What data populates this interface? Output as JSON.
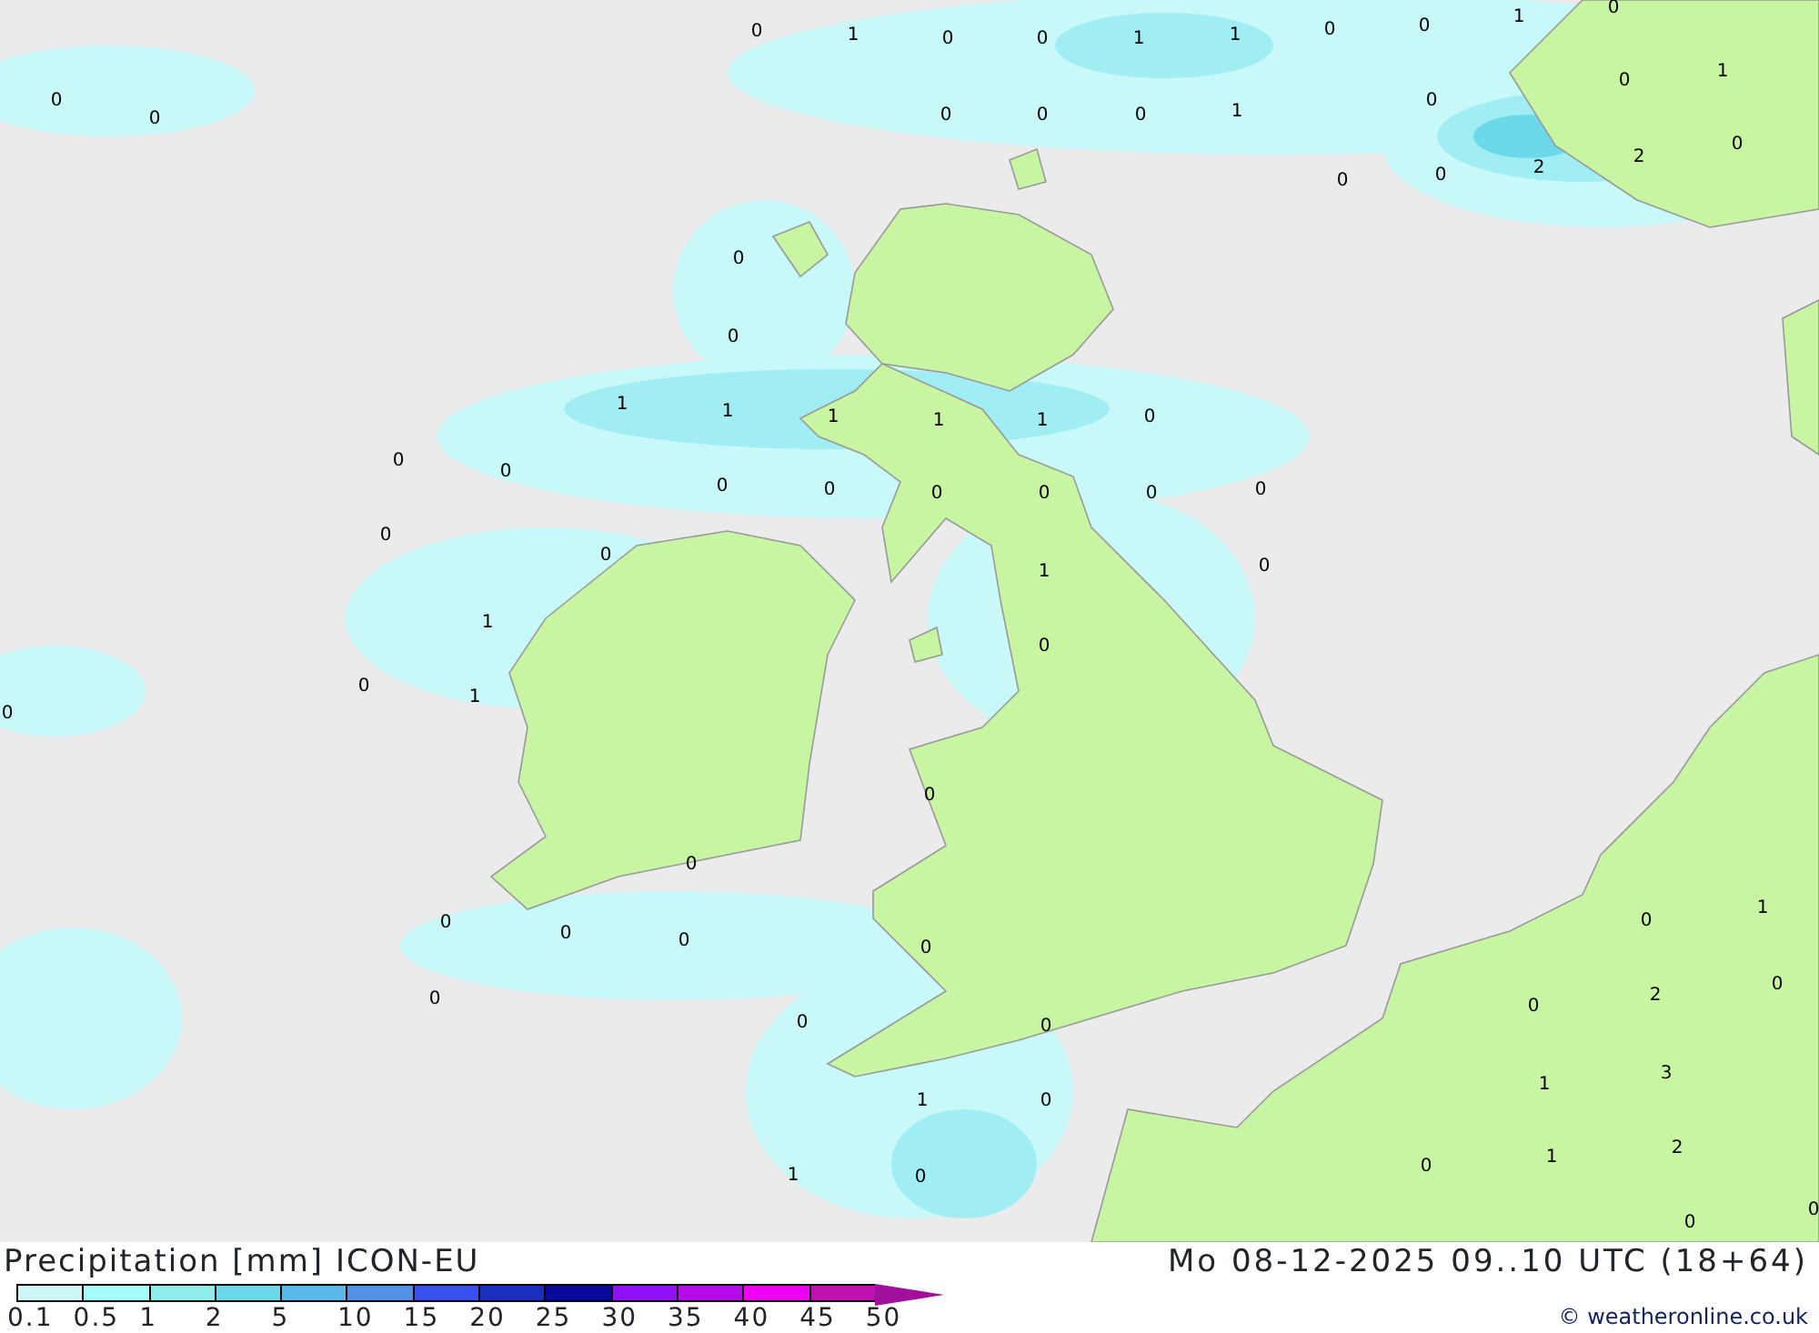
{
  "map": {
    "value_labels": [
      "0",
      "1",
      "0",
      "0",
      "1",
      "1",
      "0",
      "0",
      "1",
      "0",
      "0",
      "0",
      "1",
      "0",
      "0",
      "0",
      "0",
      "1",
      "0",
      "0",
      "2",
      "2",
      "0",
      "0",
      "0",
      "0",
      "1",
      "1",
      "1",
      "1",
      "1",
      "0",
      "0",
      "0",
      "0",
      "0",
      "0",
      "0",
      "0",
      "0",
      "0",
      "0",
      "0",
      "1",
      "1",
      "0",
      "0",
      "1",
      "0",
      "0",
      "0",
      "1",
      "0",
      "0",
      "0",
      "0",
      "0",
      "0",
      "0",
      "0",
      "2",
      "0",
      "0",
      "3",
      "1",
      "1",
      "0",
      "2",
      "1",
      "0",
      "1",
      "0",
      "0",
      "0"
    ]
  },
  "legend": {
    "title": "Precipitation [mm] ICON-EU",
    "swatches": [
      {
        "color": "#cdf6f6"
      },
      {
        "color": "#a6fbfb"
      },
      {
        "color": "#8eeeea"
      },
      {
        "color": "#6cd9ea"
      },
      {
        "color": "#5ab8e8"
      },
      {
        "color": "#5291e6"
      },
      {
        "color": "#3a4ff0"
      },
      {
        "color": "#1a2ec0"
      },
      {
        "color": "#0a0a9e"
      },
      {
        "color": "#9010f8"
      },
      {
        "color": "#b60ae8"
      },
      {
        "color": "#f000f0"
      },
      {
        "color": "#c010b0"
      },
      {
        "kind": "arrow",
        "color": "#a0109a"
      }
    ],
    "ticks": [
      "0.1",
      "0.5",
      "1",
      "2",
      "5",
      "10",
      "15",
      "20",
      "25",
      "30",
      "35",
      "40",
      "45",
      "50"
    ]
  },
  "valid_time": "Mo 08-12-2025 09..10 UTC (18+64)",
  "credit": "© weatheronline.co.uk"
}
